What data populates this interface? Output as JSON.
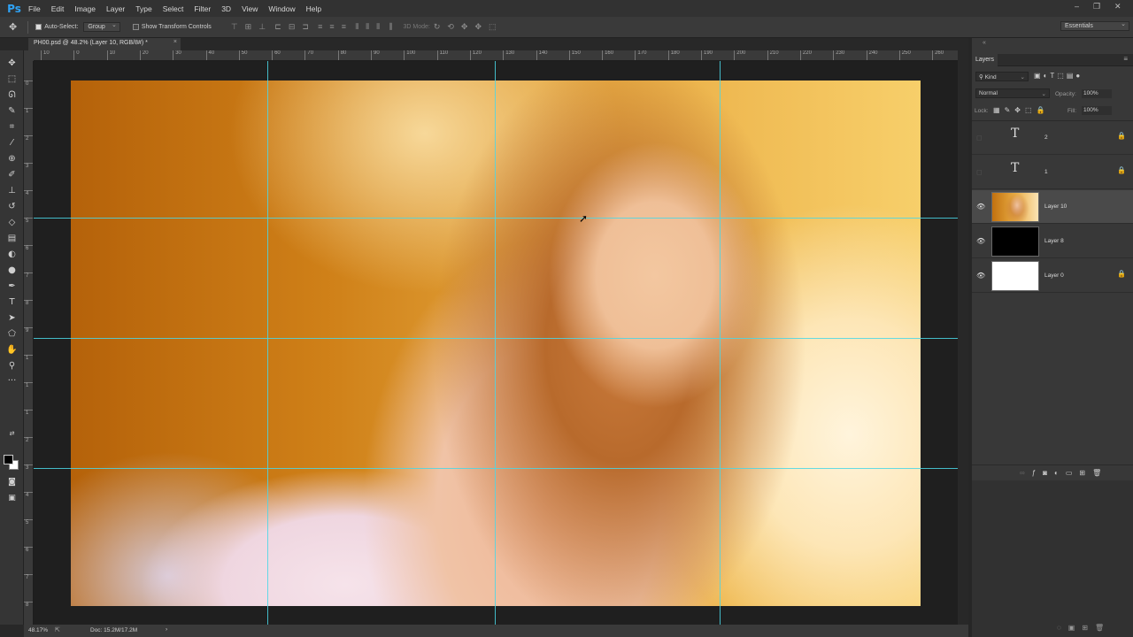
{
  "app": {
    "logo": "Ps"
  },
  "menu": [
    "File",
    "Edit",
    "Image",
    "Layer",
    "Type",
    "Select",
    "Filter",
    "3D",
    "View",
    "Window",
    "Help"
  ],
  "window_controls": {
    "minimize": "–",
    "restore": "❐",
    "close": "✕"
  },
  "options": {
    "auto_select_label": "Auto-Select:",
    "auto_select_checked": true,
    "auto_select_target": "Group",
    "transform_controls_label": "Show Transform Controls",
    "transform_controls_checked": false,
    "mode_3d_label": "3D Mode:",
    "workspace": "Essentials"
  },
  "document": {
    "tab_title": "PH00.psd @ 48.2% (Layer 10, RGB/8#) *",
    "close": "×"
  },
  "ruler": {
    "top": [
      "10",
      "0",
      "10",
      "20",
      "30",
      "40",
      "50",
      "60",
      "70",
      "80",
      "90",
      "100",
      "110",
      "120",
      "130",
      "140",
      "150",
      "160",
      "170",
      "180",
      "190",
      "200",
      "210",
      "220",
      "230",
      "240",
      "250",
      "260"
    ],
    "left": [
      "0",
      "1",
      "2",
      "3",
      "4",
      "5",
      "6",
      "7",
      "8",
      "9",
      "1",
      "1",
      "1",
      "2",
      "3",
      "4",
      "5",
      "6",
      "7",
      "8"
    ]
  },
  "tools": [
    {
      "name": "move-tool-icon",
      "glyph": "✥"
    },
    {
      "name": "marquee-tool-icon",
      "glyph": "⬚"
    },
    {
      "name": "lasso-tool-icon",
      "glyph": "ᘏ"
    },
    {
      "name": "quick-select-tool-icon",
      "glyph": "✎"
    },
    {
      "name": "crop-tool-icon",
      "glyph": "⌗"
    },
    {
      "name": "eyedropper-tool-icon",
      "glyph": "⁄"
    },
    {
      "name": "healing-brush-tool-icon",
      "glyph": "⊕"
    },
    {
      "name": "brush-tool-icon",
      "glyph": "✐"
    },
    {
      "name": "clone-stamp-tool-icon",
      "glyph": "⊥"
    },
    {
      "name": "history-brush-tool-icon",
      "glyph": "↺"
    },
    {
      "name": "eraser-tool-icon",
      "glyph": "◇"
    },
    {
      "name": "gradient-tool-icon",
      "glyph": "▤"
    },
    {
      "name": "blur-tool-icon",
      "glyph": "◐"
    },
    {
      "name": "dodge-tool-icon",
      "glyph": "●"
    },
    {
      "name": "pen-tool-icon",
      "glyph": "✒"
    },
    {
      "name": "type-tool-icon",
      "glyph": "T"
    },
    {
      "name": "path-select-tool-icon",
      "glyph": "➤"
    },
    {
      "name": "shape-tool-icon",
      "glyph": "⬠"
    },
    {
      "name": "hand-tool-icon",
      "glyph": "✋"
    },
    {
      "name": "zoom-tool-icon",
      "glyph": "⚲"
    },
    {
      "name": "more-tools-icon",
      "glyph": "···"
    }
  ],
  "status": {
    "zoom": "48.17%",
    "doc_size": "Doc: 15.2M/17.2M",
    "arrow": "›"
  },
  "layers_panel": {
    "tab": "Layers",
    "filter_kind": "Kind",
    "blend_mode": "Normal",
    "opacity_label": "Opacity:",
    "opacity_value": "100%",
    "lock_label": "Lock:",
    "fill_label": "Fill:",
    "fill_value": "100%",
    "layers": [
      {
        "name": "2",
        "type": "text",
        "visible": false,
        "locked": true,
        "selected": false
      },
      {
        "name": "1",
        "type": "text",
        "visible": false,
        "locked": true,
        "selected": false
      },
      {
        "name": "Layer 10",
        "type": "image",
        "visible": true,
        "locked": false,
        "selected": true
      },
      {
        "name": "Layer 8",
        "type": "fill-black",
        "visible": true,
        "locked": false,
        "selected": false
      },
      {
        "name": "Layer 0",
        "type": "fill-white",
        "visible": true,
        "locked": true,
        "selected": false
      }
    ]
  },
  "colors": {
    "accent_ps": "#2fa3f6",
    "guide": "#4ad7e6",
    "panel_bg": "#383838",
    "selected_layer": "#4a4a4a"
  }
}
